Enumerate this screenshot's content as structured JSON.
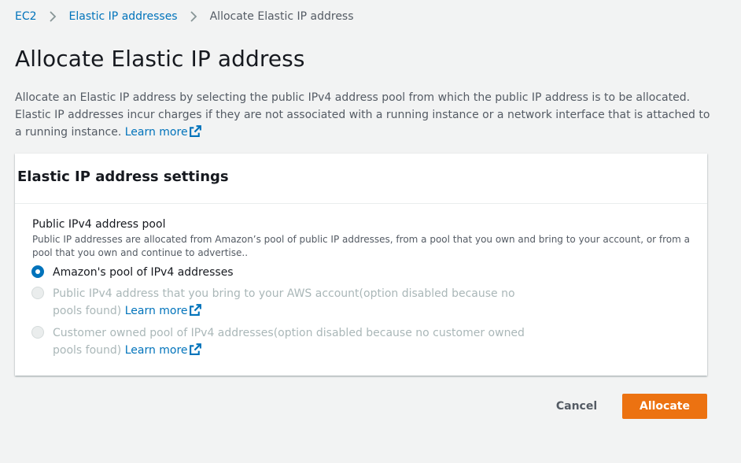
{
  "breadcrumb": {
    "items": [
      "EC2",
      "Elastic IP addresses"
    ],
    "current": "Allocate Elastic IP address"
  },
  "page": {
    "title": "Allocate Elastic IP address",
    "description": "Allocate an Elastic IP address by selecting the public IPv4 address pool from which the public IP address is to be allocated. Elastic IP addresses incur charges if they are not associated with a running instance or a network interface that is attached to a running instance.",
    "learn_more": "Learn more"
  },
  "settings": {
    "title": "Elastic IP address settings",
    "pool_label": "Public IPv4 address pool",
    "pool_description": "Public IP addresses are allocated from Amazon’s pool of public IP addresses, from a pool that you own and bring to your account, or from a pool that you own and continue to advertise..",
    "options": [
      {
        "label": "Amazon's pool of IPv4 addresses",
        "selected": true,
        "disabled": false,
        "link": ""
      },
      {
        "label": "Public IPv4 address that you bring to your AWS account(option disabled because no pools found)",
        "selected": false,
        "disabled": true,
        "link": "Learn more"
      },
      {
        "label": "Customer owned pool of IPv4 addresses(option disabled because no customer owned pools found)",
        "selected": false,
        "disabled": true,
        "link": "Learn more"
      }
    ]
  },
  "actions": {
    "cancel": "Cancel",
    "allocate": "Allocate"
  },
  "colors": {
    "accent": "#ec7211",
    "link": "#0073bb",
    "background": "#f2f3f3"
  },
  "icons": {
    "breadcrumb_separator": "chevron-right-icon",
    "external_link": "external-link-icon"
  }
}
